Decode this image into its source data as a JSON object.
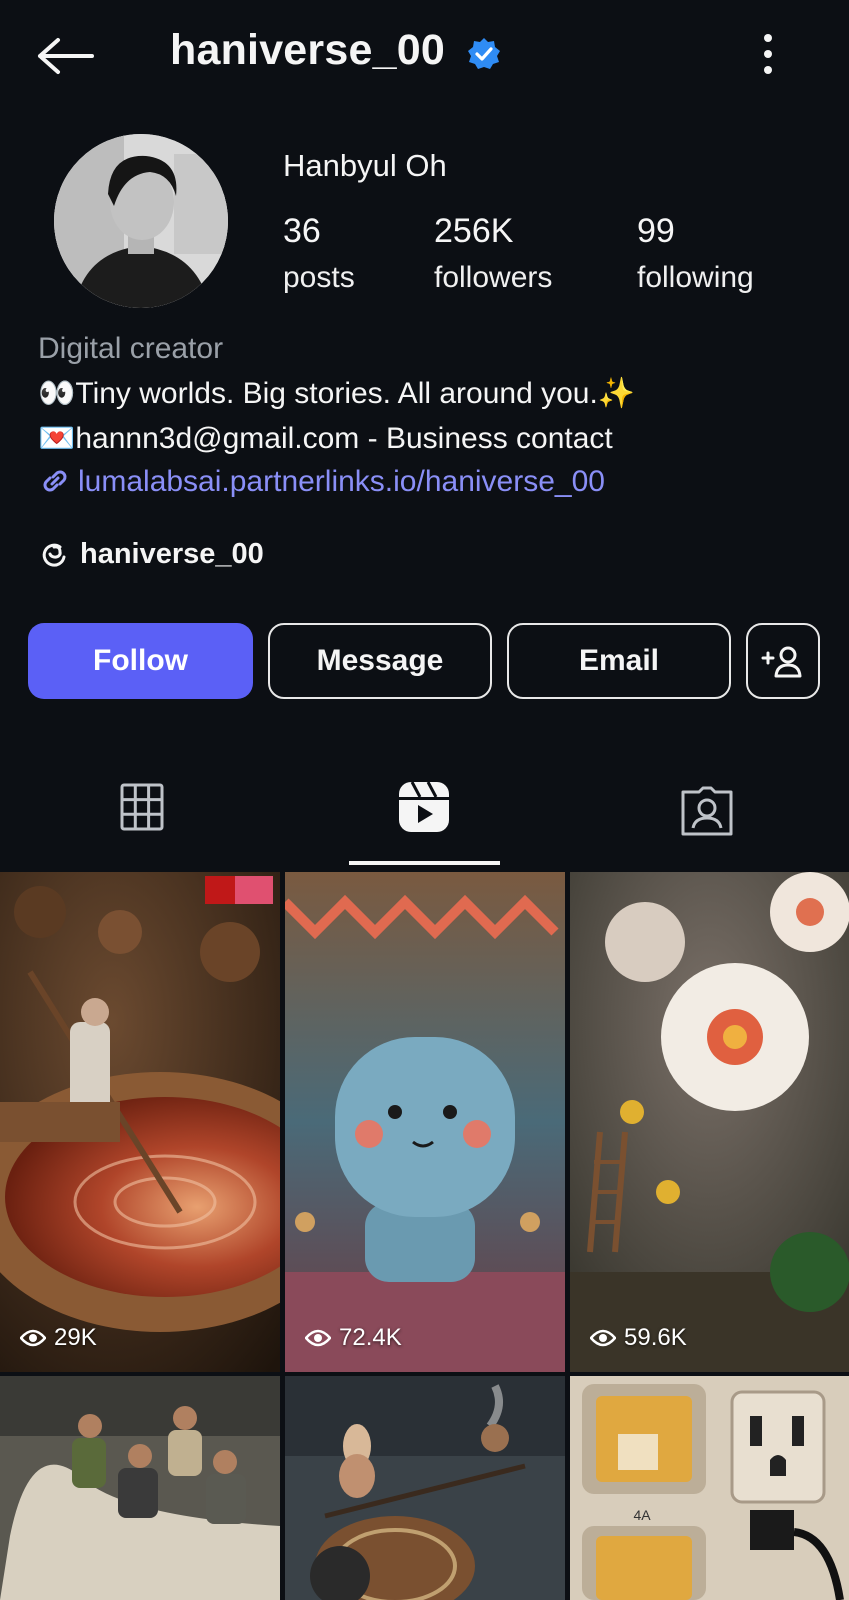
{
  "header": {
    "username": "haniverse_00",
    "icons": {
      "back": "arrow-left-icon",
      "verified": "verified-badge-icon",
      "more": "more-vertical-icon"
    }
  },
  "profile": {
    "display_name": "Hanbyul Oh",
    "stats": [
      {
        "value": "36",
        "label": "posts"
      },
      {
        "value": "256K",
        "label": "followers"
      },
      {
        "value": "99",
        "label": "following"
      }
    ],
    "category": "Digital creator",
    "bio_line1": "👀Tiny worlds. Big stories. All around you.✨",
    "bio_line2": "💌hannn3d@gmail.com - Business contact",
    "link": "lumalabsai.partnerlinks.io/haniverse_00",
    "threads_handle": "haniverse_00"
  },
  "actions": {
    "follow": "Follow",
    "message": "Message",
    "email": "Email"
  },
  "tabs": {
    "icons": [
      "grid-icon",
      "reels-icon",
      "tagged-icon"
    ],
    "active": "reels"
  },
  "reels": [
    {
      "views": "29K",
      "subject": "miniature cook stirring giant pot of sauce"
    },
    {
      "views": "72.4K",
      "subject": "fuzzy blue plush character with tiny figures"
    },
    {
      "views": "59.6K",
      "subject": "tiny workers on ladder beside white flower"
    },
    {
      "views": "",
      "subject": "miniature workers carving wood"
    },
    {
      "views": "",
      "subject": "tiny rabbit with roasting drum"
    },
    {
      "views": "",
      "subject": "tiny rooms inside wall outlet"
    }
  ],
  "colors": {
    "background": "#0c0f14",
    "follow_button": "#5b60f6",
    "link": "#8a8ff7",
    "verified": "#2f8cf5",
    "muted_text": "#9aa0a8"
  }
}
